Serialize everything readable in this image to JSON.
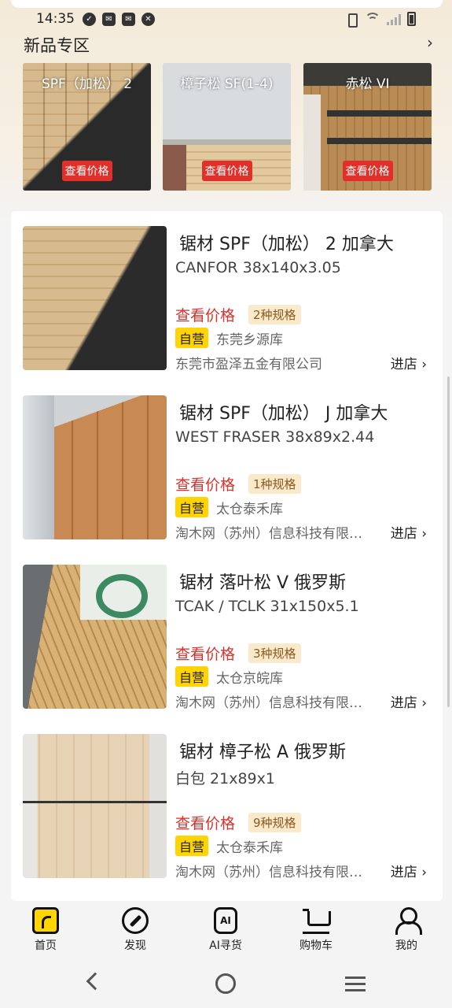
{
  "status_bar": {
    "time": "14:35"
  },
  "new_section": {
    "title": "新品专区",
    "more_icon": "chevron-right-icon",
    "items": [
      {
        "label": "SPF（加松） 2",
        "price_button": "查看价格"
      },
      {
        "label": "樟子松 SF(1-4)",
        "price_button": "查看价格"
      },
      {
        "label": "赤松 VI",
        "price_button": "查看价格"
      }
    ]
  },
  "products": [
    {
      "name": "锯材 SPF（加松） 2 加拿大",
      "spec": "CANFOR 38x140x3.05",
      "price_label": "查看价格",
      "spec_count": "2种规格",
      "self_operated": "自营",
      "warehouse": "东莞乡源库",
      "company": "东莞市盈泽五金有限公司",
      "enter_store": "进店 ›"
    },
    {
      "name": "锯材 SPF（加松） J 加拿大",
      "spec": "WEST FRASER 38x89x2.44",
      "price_label": "查看价格",
      "spec_count": "1种规格",
      "self_operated": "自营",
      "warehouse": "太仓泰禾库",
      "company": "淘木网（苏州）信息科技有限…",
      "enter_store": "进店 ›"
    },
    {
      "name": "锯材 落叶松 V 俄罗斯",
      "spec": "TCAK / TCLK 31x150x5.1",
      "price_label": "查看价格",
      "spec_count": "3种规格",
      "self_operated": "自营",
      "warehouse": "太仓京皖库",
      "company": "淘木网（苏州）信息科技有限…",
      "enter_store": "进店 ›"
    },
    {
      "name": "锯材 樟子松 A 俄罗斯",
      "spec": "白包 21x89x1",
      "price_label": "查看价格",
      "spec_count": "9种规格",
      "self_operated": "自营",
      "warehouse": "太仓泰禾库",
      "company": "淘木网（苏州）信息科技有限…",
      "enter_store": "进店 ›"
    }
  ],
  "bottom_nav": [
    {
      "label": "首页",
      "icon": "home-icon",
      "active": true
    },
    {
      "label": "发现",
      "icon": "compass-icon"
    },
    {
      "label": "AI寻货",
      "icon": "ai-icon",
      "icon_text": "AI"
    },
    {
      "label": "购物车",
      "icon": "cart-icon"
    },
    {
      "label": "我的",
      "icon": "user-icon"
    }
  ],
  "colors": {
    "accent_yellow": "#ffd400",
    "price_red": "#d8322c",
    "chip_bg": "#fbe9cc"
  }
}
